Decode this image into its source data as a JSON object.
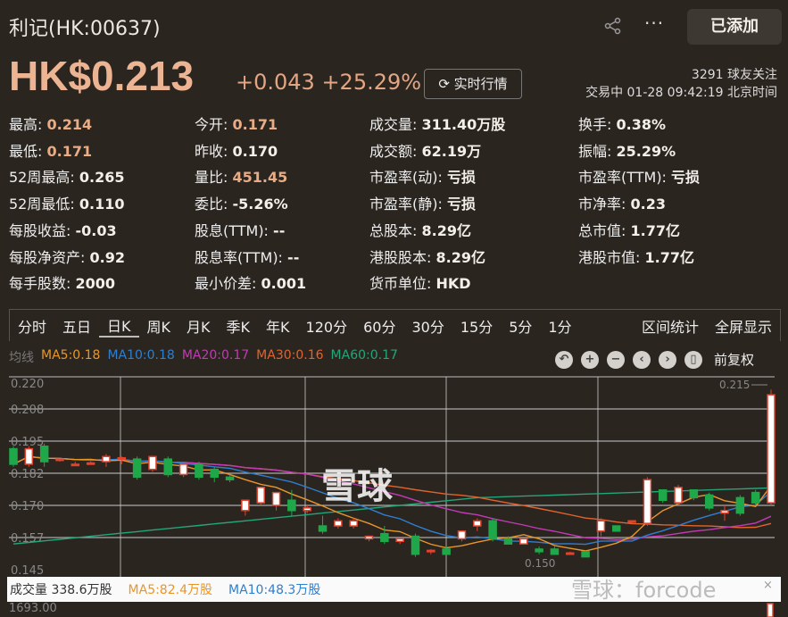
{
  "header": {
    "title": "利记(HK:00637)",
    "added_label": "已添加",
    "more": "···"
  },
  "quote": {
    "price": "HK$0.213",
    "change": "+0.043 +25.29%",
    "realtime_label": "实时行情",
    "followers": "3291 球友关注",
    "status": "交易中 01-28 09:42:19 北京时间"
  },
  "stats": [
    [
      {
        "k": "最高:",
        "v": "0.214",
        "up": true
      },
      {
        "k": "今开:",
        "v": "0.171",
        "up": true
      },
      {
        "k": "成交量:",
        "v": "311.40万股"
      },
      {
        "k": "换手:",
        "v": "0.38%"
      }
    ],
    [
      {
        "k": "最低:",
        "v": "0.171",
        "up": true
      },
      {
        "k": "昨收:",
        "v": "0.170"
      },
      {
        "k": "成交额:",
        "v": "62.19万"
      },
      {
        "k": "振幅:",
        "v": "25.29%"
      }
    ],
    [
      {
        "k": "52周最高:",
        "v": "0.265"
      },
      {
        "k": "量比:",
        "v": "451.45",
        "up": true
      },
      {
        "k": "市盈率(动):",
        "v": "亏损"
      },
      {
        "k": "市盈率(TTM):",
        "v": "亏损"
      }
    ],
    [
      {
        "k": "52周最低:",
        "v": "0.110"
      },
      {
        "k": "委比:",
        "v": "-5.26%"
      },
      {
        "k": "市盈率(静):",
        "v": "亏损"
      },
      {
        "k": "市净率:",
        "v": "0.23"
      }
    ],
    [
      {
        "k": "每股收益:",
        "v": "-0.03"
      },
      {
        "k": "股息(TTM):",
        "v": "--"
      },
      {
        "k": "总股本:",
        "v": "8.29亿"
      },
      {
        "k": "总市值:",
        "v": "1.77亿"
      }
    ],
    [
      {
        "k": "每股净资产:",
        "v": "0.92"
      },
      {
        "k": "股息率(TTM):",
        "v": "--"
      },
      {
        "k": "港股股本:",
        "v": "8.29亿"
      },
      {
        "k": "港股市值:",
        "v": "1.77亿"
      }
    ],
    [
      {
        "k": "每手股数:",
        "v": "2000"
      },
      {
        "k": "最小价差:",
        "v": "0.001"
      },
      {
        "k": "货币单位:",
        "v": "HKD"
      }
    ]
  ],
  "tabs": [
    "分时",
    "五日",
    "日K",
    "周K",
    "月K",
    "季K",
    "年K",
    "120分",
    "60分",
    "30分",
    "15分",
    "5分",
    "1分"
  ],
  "tabs_right": [
    "区间统计",
    "全屏显示"
  ],
  "legend": {
    "label": "均线",
    "items": [
      {
        "t": "MA5:0.18",
        "c": "#e8962a"
      },
      {
        "t": "MA10:0.18",
        "c": "#2f7fd0"
      },
      {
        "t": "MA20:0.17",
        "c": "#c23bb5"
      },
      {
        "t": "MA30:0.16",
        "c": "#e0642e"
      },
      {
        "t": "MA60:0.17",
        "c": "#22a67a"
      }
    ]
  },
  "controls": {
    "fq": "前复权"
  },
  "volume": {
    "label": "成交量 338.6万股",
    "ma5": "MA5:82.4万股",
    "ma10": "MA10:48.3万股",
    "axis": "1693.00"
  },
  "watermark": "雪球：forcode",
  "center_watermark": "雪球",
  "chart_data": {
    "type": "candlestick",
    "ylim": [
      0.145,
      0.22
    ],
    "yticks": [
      "0.220",
      "0.208",
      "0.195",
      "0.182",
      "0.170",
      "0.157",
      "0.145"
    ],
    "annotations": {
      "max": "0.215",
      "min": "0.150"
    },
    "ohlc": [
      [
        0.192,
        0.193,
        0.185,
        0.186
      ],
      [
        0.186,
        0.193,
        0.185,
        0.192
      ],
      [
        0.193,
        0.194,
        0.185,
        0.187
      ],
      [
        0.188,
        0.188,
        0.187,
        0.188
      ],
      [
        0.186,
        0.187,
        0.186,
        0.186
      ],
      [
        0.186,
        0.187,
        0.186,
        0.1865
      ],
      [
        0.187,
        0.19,
        0.185,
        0.189
      ],
      [
        0.188,
        0.189,
        0.186,
        0.1885
      ],
      [
        0.188,
        0.189,
        0.18,
        0.181
      ],
      [
        0.184,
        0.189,
        0.183,
        0.189
      ],
      [
        0.188,
        0.189,
        0.181,
        0.182
      ],
      [
        0.182,
        0.186,
        0.181,
        0.186
      ],
      [
        0.186,
        0.187,
        0.18,
        0.181
      ],
      [
        0.184,
        0.185,
        0.179,
        0.181
      ],
      [
        0.181,
        0.182,
        0.179,
        0.18
      ],
      [
        0.168,
        0.172,
        0.166,
        0.172
      ],
      [
        0.171,
        0.177,
        0.17,
        0.177
      ],
      [
        0.17,
        0.175,
        0.168,
        0.175
      ],
      [
        0.172,
        0.176,
        0.166,
        0.168
      ],
      [
        0.168,
        0.17,
        0.167,
        0.169
      ],
      [
        0.162,
        0.166,
        0.159,
        0.16
      ],
      [
        0.162,
        0.165,
        0.161,
        0.164
      ],
      [
        0.162,
        0.165,
        0.161,
        0.164
      ],
      [
        0.157,
        0.158,
        0.156,
        0.158
      ],
      [
        0.159,
        0.162,
        0.155,
        0.156
      ],
      [
        0.156,
        0.157,
        0.155,
        0.157
      ],
      [
        0.158,
        0.159,
        0.15,
        0.151
      ],
      [
        0.152,
        0.153,
        0.151,
        0.1525
      ],
      [
        0.153,
        0.154,
        0.151,
        0.151
      ],
      [
        0.157,
        0.16,
        0.156,
        0.16
      ],
      [
        0.162,
        0.165,
        0.16,
        0.164
      ],
      [
        0.164,
        0.165,
        0.156,
        0.157
      ],
      [
        0.157,
        0.158,
        0.155,
        0.155
      ],
      [
        0.155,
        0.157,
        0.155,
        0.157
      ],
      [
        0.153,
        0.154,
        0.151,
        0.152
      ],
      [
        0.153,
        0.154,
        0.151,
        0.151
      ],
      [
        0.151,
        0.152,
        0.151,
        0.1515
      ],
      [
        0.152,
        0.152,
        0.15,
        0.15
      ],
      [
        0.16,
        0.165,
        0.158,
        0.164
      ],
      [
        0.162,
        0.162,
        0.16,
        0.16
      ],
      [
        0.1635,
        0.164,
        0.163,
        0.164
      ],
      [
        0.163,
        0.181,
        0.162,
        0.18
      ],
      [
        0.176,
        0.176,
        0.171,
        0.172
      ],
      [
        0.171,
        0.178,
        0.17,
        0.177
      ],
      [
        0.176,
        0.176,
        0.172,
        0.173
      ],
      [
        0.174,
        0.175,
        0.168,
        0.169
      ],
      [
        0.167,
        0.17,
        0.164,
        0.168
      ],
      [
        0.173,
        0.174,
        0.166,
        0.167
      ],
      [
        0.175,
        0.176,
        0.17,
        0.171
      ],
      [
        0.171,
        0.215,
        0.17,
        0.213
      ]
    ],
    "up_color": "#e0442e",
    "down_color": "#1fa84a"
  }
}
